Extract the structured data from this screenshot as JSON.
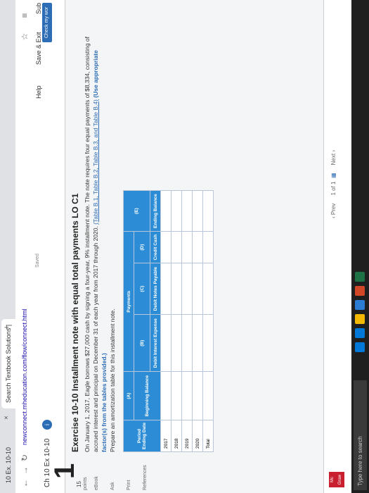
{
  "browser": {
    "tabs": [
      {
        "label": "10 Ex. 10-10"
      },
      {
        "label": "Search Textbook Solutions |"
      }
    ],
    "url": "newconnect.mheducation.com/flow/connect.html"
  },
  "app": {
    "assignment": "Ch 10 Ex 10-10",
    "saved": "Saved",
    "help": "Help",
    "save_exit": "Save & Exit",
    "submit": "Sub",
    "check": "Check my wor"
  },
  "question": {
    "number": "1",
    "points": "15",
    "points_label": "points",
    "side_items": [
      "eBook",
      "Ask",
      "Print",
      "References"
    ],
    "title": "Exercise 10-10 Installment note with equal total payments LO C1",
    "prompt": "On January 1, 2017, Eagle borrows $27,000 cash by signing a four-year, 9% installment note. The note requires four equal payments of $8,334, consisting of accrued interest and principal on December 31 of each year from 2017 through 2020.",
    "prompt_links": "(Table B.1, Table B.2, Table B.3, and Table B.4)",
    "prompt_bold": "(Use appropriate factor(s) from the tables provided.)",
    "instruction": "Prepare an amortization table for this installment note."
  },
  "table": {
    "payments_label": "Payments",
    "letters": [
      "(A)",
      "(B)",
      "(C)",
      "(D)",
      "(E)"
    ],
    "headers": [
      "Period Ending Date",
      "Beginning Balance",
      "Debit Interest Expense",
      "Debit Notes Payable",
      "Credit Cash",
      "Ending Balance"
    ],
    "rows": [
      "2017",
      "2018",
      "2019",
      "2020",
      "Total"
    ]
  },
  "pager": {
    "prev": "Prev",
    "page": "1",
    "of": "of 1",
    "next": "Next"
  },
  "footer": {
    "logo": "Mc Graw Hill"
  },
  "taskbar": {
    "search": "Type here to search"
  }
}
